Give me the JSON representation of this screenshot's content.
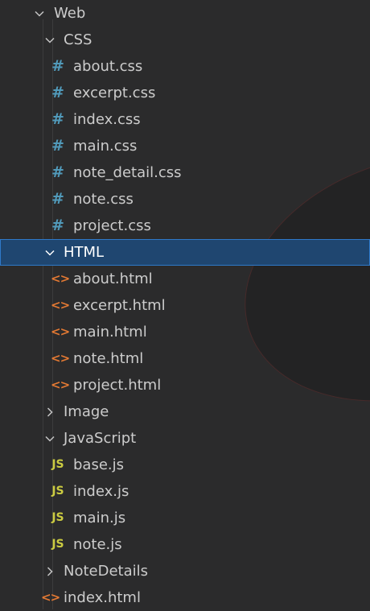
{
  "tree": {
    "root": {
      "label": "Web",
      "expanded": true
    },
    "folders": [
      {
        "label": "CSS",
        "expanded": true,
        "files": [
          {
            "name": "about.css",
            "icon": "css-hash-icon"
          },
          {
            "name": "excerpt.css",
            "icon": "css-hash-icon"
          },
          {
            "name": "index.css",
            "icon": "css-hash-icon"
          },
          {
            "name": "main.css",
            "icon": "css-hash-icon"
          },
          {
            "name": "note_detail.css",
            "icon": "css-hash-icon"
          },
          {
            "name": "note.css",
            "icon": "css-hash-icon"
          },
          {
            "name": "project.css",
            "icon": "css-hash-icon"
          }
        ]
      },
      {
        "label": "HTML",
        "expanded": true,
        "selected": true,
        "files": [
          {
            "name": "about.html",
            "icon": "html-brackets-icon"
          },
          {
            "name": "excerpt.html",
            "icon": "html-brackets-icon"
          },
          {
            "name": "main.html",
            "icon": "html-brackets-icon"
          },
          {
            "name": "note.html",
            "icon": "html-brackets-icon"
          },
          {
            "name": "project.html",
            "icon": "html-brackets-icon"
          }
        ]
      },
      {
        "label": "Image",
        "expanded": false,
        "files": []
      },
      {
        "label": "JavaScript",
        "expanded": true,
        "files": [
          {
            "name": "base.js",
            "icon": "js-icon"
          },
          {
            "name": "index.js",
            "icon": "js-icon"
          },
          {
            "name": "main.js",
            "icon": "js-icon"
          },
          {
            "name": "note.js",
            "icon": "js-icon"
          }
        ]
      },
      {
        "label": "NoteDetails",
        "expanded": false,
        "files": []
      }
    ],
    "root_files": [
      {
        "name": "index.html",
        "icon": "html-brackets-icon"
      }
    ],
    "icon_glyphs": {
      "css": "#",
      "html": "<>",
      "js": "JS"
    },
    "colors": {
      "background": "#2b2b2c",
      "text": "#cccccc",
      "selected_background": "#1f4670",
      "selected_border": "#2f79c9",
      "css_icon": "#519aba",
      "html_icon": "#e37933",
      "js_icon": "#cbcb41"
    }
  }
}
